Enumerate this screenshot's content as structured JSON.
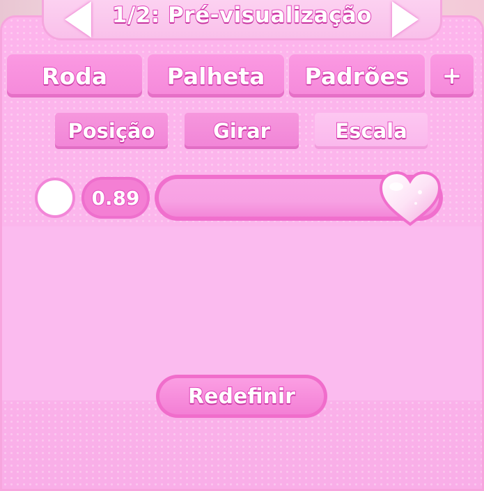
{
  "header": {
    "title": "1/2: Pré-visualização",
    "prev_icon": "arrow-left-icon",
    "next_icon": "arrow-right-icon"
  },
  "tabs": [
    {
      "label": "Roda"
    },
    {
      "label": "Palheta"
    },
    {
      "label": "Padrões"
    },
    {
      "label": "+"
    }
  ],
  "subtabs": [
    {
      "label": "Posição",
      "active": false
    },
    {
      "label": "Girar",
      "active": false
    },
    {
      "label": "Escala",
      "active": true
    }
  ],
  "scale": {
    "value_text": "0.89",
    "slider_value": 1.0,
    "handle_icon": "heart-icon",
    "indicator_icon": "circle-icon"
  },
  "reset_label": "Redefinir",
  "colors": {
    "accent": "#f06fcd",
    "panel": "#fbb6ec",
    "text_outline": "#e13fb9"
  }
}
